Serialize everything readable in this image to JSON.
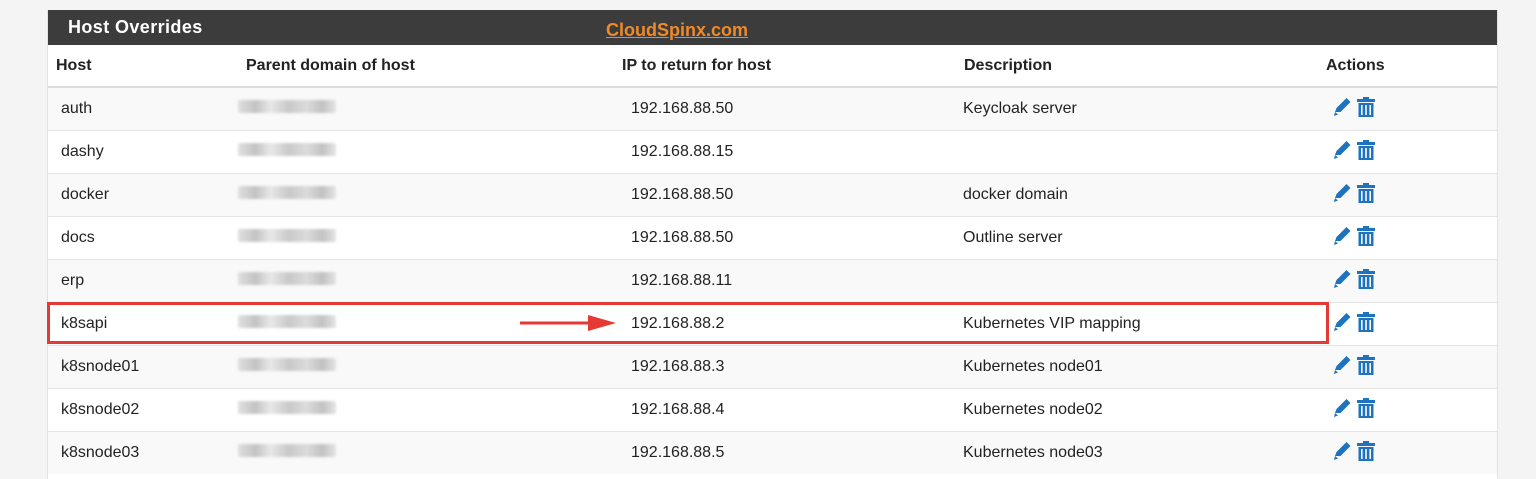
{
  "panel": {
    "title": "Host Overrides",
    "watermark": "CloudSpinx.com"
  },
  "table": {
    "headers": {
      "host": "Host",
      "parent": "Parent domain of host",
      "ip": "IP to return for host",
      "description": "Description",
      "actions": "Actions"
    },
    "rows": [
      {
        "host": "auth",
        "ip": "192.168.88.50",
        "description": "Keycloak server"
      },
      {
        "host": "dashy",
        "ip": "192.168.88.15",
        "description": ""
      },
      {
        "host": "docker",
        "ip": "192.168.88.50",
        "description": "docker domain"
      },
      {
        "host": "docs",
        "ip": "192.168.88.50",
        "description": "Outline server"
      },
      {
        "host": "erp",
        "ip": "192.168.88.11",
        "description": ""
      },
      {
        "host": "k8sapi",
        "ip": "192.168.88.2",
        "description": "Kubernetes VIP mapping"
      },
      {
        "host": "k8snode01",
        "ip": "192.168.88.3",
        "description": "Kubernetes node01"
      },
      {
        "host": "k8snode02",
        "ip": "192.168.88.4",
        "description": "Kubernetes node02"
      },
      {
        "host": "k8snode03",
        "ip": "192.168.88.5",
        "description": "Kubernetes node03"
      }
    ]
  },
  "icons": {
    "edit": "pencil-icon",
    "delete": "trash-icon"
  },
  "colors": {
    "header_bg": "#3c3c3c",
    "watermark": "#f08a28",
    "icon_blue": "#1e73be",
    "highlight": "#e53935"
  }
}
